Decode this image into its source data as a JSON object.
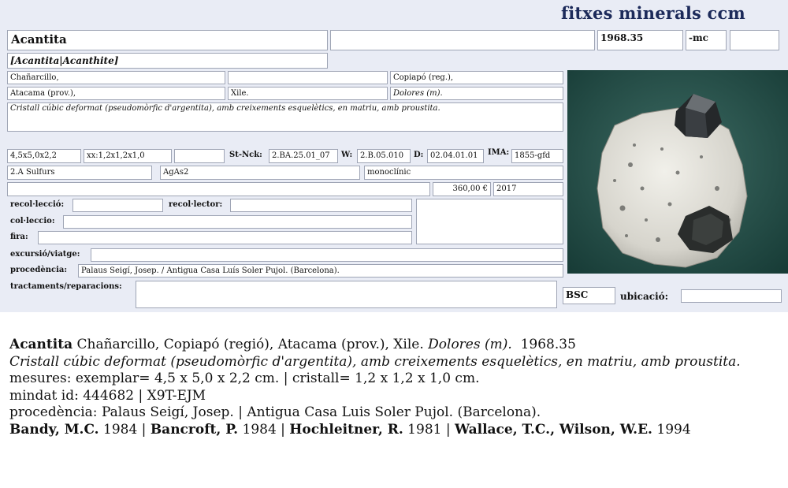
{
  "brand": "fitxes minerals ccm",
  "card": {
    "name": "Acantita",
    "name_extra": "",
    "number": "1968.35",
    "suffix": "-mc",
    "suffix_extra": "",
    "synonym": "[Acantita|Acanthite]",
    "locality": "Chañarcillo,",
    "locality_2": "",
    "region": "Copiapó (reg.),",
    "province": "Atacama (prov.),",
    "country": "Xile.",
    "mine": "Dolores (m).",
    "description": "Cristall cúbic deformat (pseudomòrfic d'argentita), amb creixements esquelètics, en matriu, amb proustita.",
    "size": "4,5x5,0x2,2",
    "crystal_size": "xx:1,2x1,2x1,0",
    "size_extra": "",
    "strunz_label": "St-Nck:",
    "strunz": "2.BA.25.01_07",
    "w_label": "W:",
    "w": "2.B.05.010",
    "d_label": "D:",
    "d": "02.04.01.01",
    "ima_label": "IMA:",
    "ima": "1855-gfd",
    "class": "2.A Sulfurs",
    "formula": "AgAs2",
    "system": "monoclínic",
    "notes": "",
    "price": "360,00 €",
    "year": "2017",
    "recol_leccio_label": "recol·lecció:",
    "recol_leccio": "",
    "recol_lector_label": "recol·lector:",
    "recol_lector": "",
    "col_leccio_label": "col·leccio:",
    "col_leccio": "",
    "fira_label": "fira:",
    "fira": "",
    "excursio_label": "excursió/viatge:",
    "excursio": "",
    "procedencia_label": "procedència:",
    "procedencia": "Palaus Seigí, Josep. / Antigua Casa Luís Soler Pujol. (Barcelona).",
    "tractaments_label": "tractaments/reparacions:",
    "tractaments": "",
    "side_box": "",
    "bsc": "BSC",
    "ubicacio_label": "ubicació:",
    "ubicacio": ""
  },
  "caption": {
    "l1_name": "Acantita",
    "l1_loc": " Chañarcillo, Copiapó (regió), Atacama (prov.), Xile. ",
    "l1_mine": "Dolores (m).",
    "l1_num": "  1968.35",
    "description": "Cristall cúbic deformat (pseudomòrfic d'argentita), amb creixements esquelètics, en matriu, amb proustita.",
    "mesures": "mesures: exemplar= 4,5 x 5,0 x 2,2 cm. | cristall= 1,2 x 1,2 x 1,0 cm.",
    "mindat": "mindat id: 444682 | X9T-EJM",
    "procedencia": "procedència: Palaus Seigí, Josep. | Antigua Casa Luis Soler Pujol. (Barcelona).",
    "refs": [
      {
        "author": "Bandy, M.C.",
        "year": " 1984 | "
      },
      {
        "author": "Bancroft, P.",
        "year": " 1984 | "
      },
      {
        "author": "Hochleitner, R.",
        "year": " 1981 | "
      },
      {
        "author": "Wallace, T.C., Wilson, W.E.",
        "year": " 1994"
      }
    ]
  },
  "photo": {
    "icon": "mineral-specimen-photo",
    "background": "#1f4a44"
  }
}
